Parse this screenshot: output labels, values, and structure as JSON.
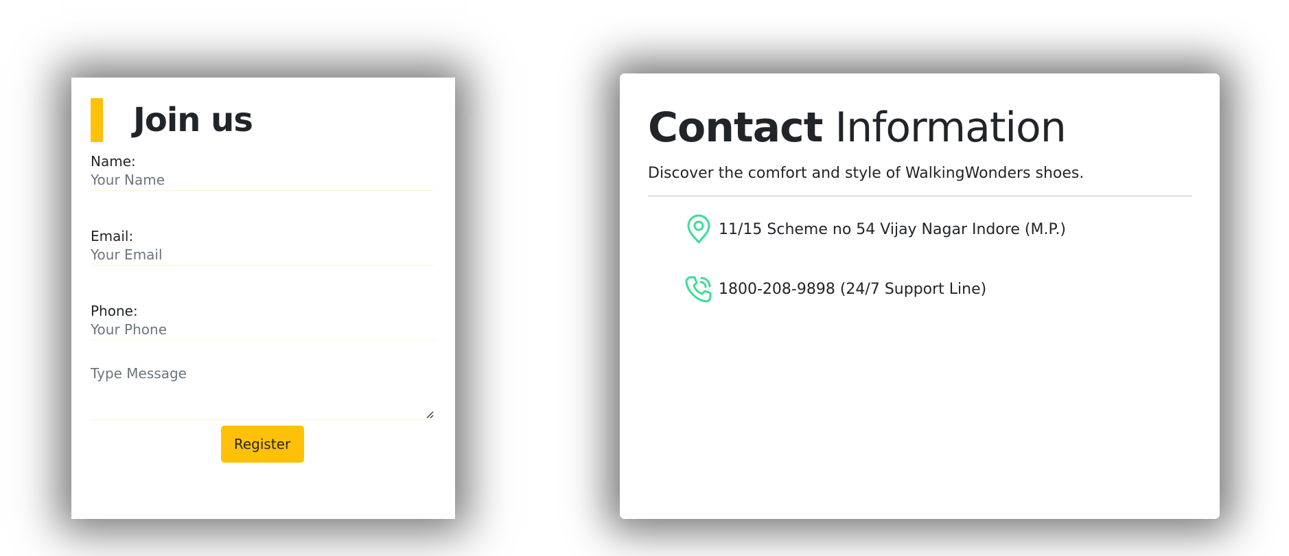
{
  "join": {
    "title": "Join us",
    "name_label": "Name:",
    "name_placeholder": "Your Name",
    "email_label": "Email:",
    "email_placeholder": "Your Email",
    "phone_label": "Phone:",
    "phone_placeholder": "Your Phone",
    "message_placeholder": "Type Message",
    "register_label": "Register"
  },
  "contact": {
    "title_bold": "Contact",
    "title_rest": "Information",
    "subtitle": "Discover the comfort and style of WalkingWonders shoes.",
    "items": [
      {
        "icon": "location-pin-icon",
        "text": "11/15 Scheme no 54 Vijay Nagar Indore (M.P.)"
      },
      {
        "icon": "phone-icon",
        "text": "1800-208-9898 (24/7 Support Line)"
      }
    ]
  },
  "colors": {
    "accent": "#ffc107",
    "icon_green": "#3ddc97",
    "text": "#212529",
    "placeholder": "#6c757d"
  }
}
